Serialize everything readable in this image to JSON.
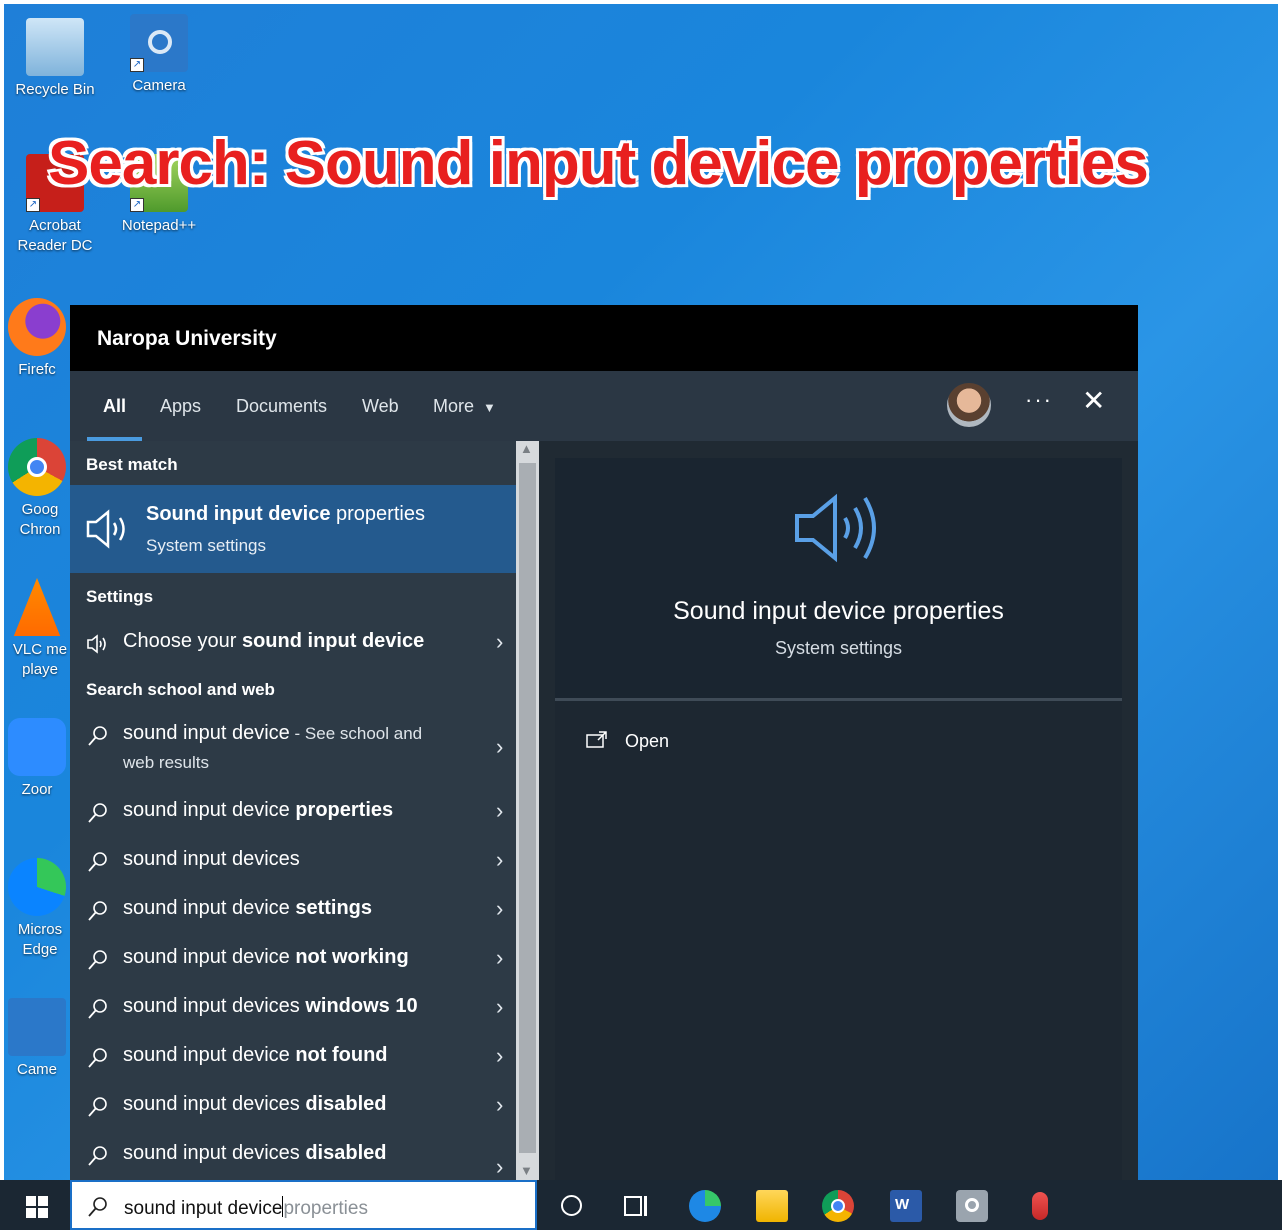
{
  "desktop": {
    "icons": [
      {
        "label": "Recycle Bin"
      },
      {
        "label": "Camera"
      },
      {
        "label": "Acrobat Reader DC"
      },
      {
        "label": "Notepad++"
      },
      {
        "label": "Firefc"
      },
      {
        "label": "Goog Chron"
      },
      {
        "label": "VLC me playe"
      },
      {
        "label": "Zoor"
      },
      {
        "label": "Micros Edge"
      },
      {
        "label": "Came"
      }
    ]
  },
  "headline": "Search: Sound input device properties",
  "panel": {
    "org": "Naropa University",
    "tabs": [
      "All",
      "Apps",
      "Documents",
      "Web",
      "More"
    ],
    "more_icon": "caret-down-icon",
    "more_options": "···",
    "close": "✕"
  },
  "results": {
    "best_match_label": "Best match",
    "best_match": {
      "title_a": "Sound input device",
      "title_b": " properties",
      "subtitle": "System settings"
    },
    "settings_label": "Settings",
    "settings_item": {
      "prefix": "Choose your ",
      "bold": "sound input device"
    },
    "web_label": "Search school and web",
    "web_first": {
      "text": "sound input device",
      "suffix": " - See school and",
      "suffix2": "web results"
    },
    "suggestions": [
      {
        "prefix": "sound input device ",
        "bold": "properties"
      },
      {
        "prefix": "sound input devices",
        "bold": ""
      },
      {
        "prefix": "sound input device ",
        "bold": "settings"
      },
      {
        "prefix": "sound input device ",
        "bold": "not working"
      },
      {
        "prefix": "sound input devices ",
        "bold": "windows 10"
      },
      {
        "prefix": "sound input device ",
        "bold": "not found"
      },
      {
        "prefix": "sound input devices ",
        "bold": "disabled"
      },
      {
        "prefix": "sound input devices ",
        "bold": "disabled"
      }
    ]
  },
  "detail": {
    "title": "Sound input device properties",
    "subtitle": "System settings",
    "action": "Open"
  },
  "taskbar": {
    "search_typed": "sound input device",
    "search_ghost": "properties"
  },
  "colors": {
    "accent": "#245a8e",
    "headline": "#e8201f",
    "panel_bg": "#202a33"
  }
}
